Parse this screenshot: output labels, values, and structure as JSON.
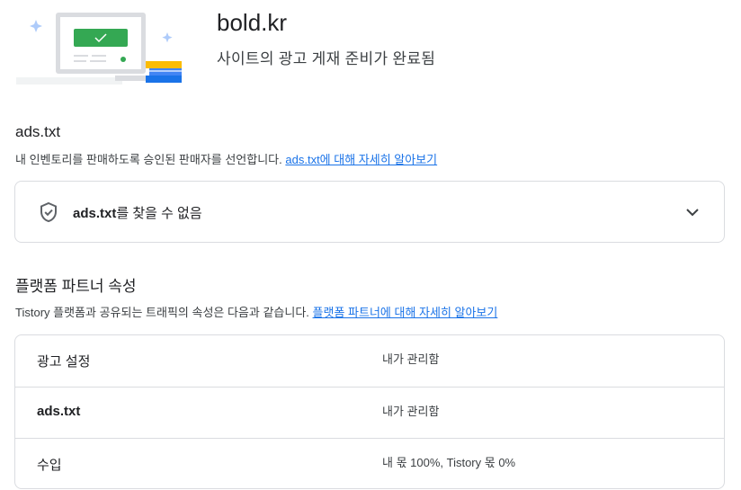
{
  "site": {
    "domain": "bold.kr",
    "status": "사이트의 광고 게재 준비가 완료됨"
  },
  "ads_txt": {
    "title": "ads.txt",
    "description": "내 인벤토리를 판매하도록 승인된 판매자를 선언합니다.",
    "learn_more": "ads.txt에 대해 자세히 알아보기",
    "status_bold": "ads.txt",
    "status_rest": "를 찾을 수 없음"
  },
  "platform": {
    "title": "플랫폼 파트너 속성",
    "description": "Tistory 플랫폼과 공유되는 트래픽의 속성은 다음과 같습니다.",
    "learn_more": "플랫폼 파트너에 대해 자세히 알아보기",
    "rows": [
      {
        "label": "광고 설정",
        "value": "내가 관리함"
      },
      {
        "label": "ads.txt",
        "value": "내가 관리함"
      },
      {
        "label": "수입",
        "value": "내 몫 100%, Tistory 몫 0%"
      }
    ]
  },
  "colors": {
    "accent_green": "#34a853",
    "link_blue": "#1a73e8"
  },
  "icons": {
    "status": "shield-check-icon",
    "expand": "chevron-down-icon"
  }
}
